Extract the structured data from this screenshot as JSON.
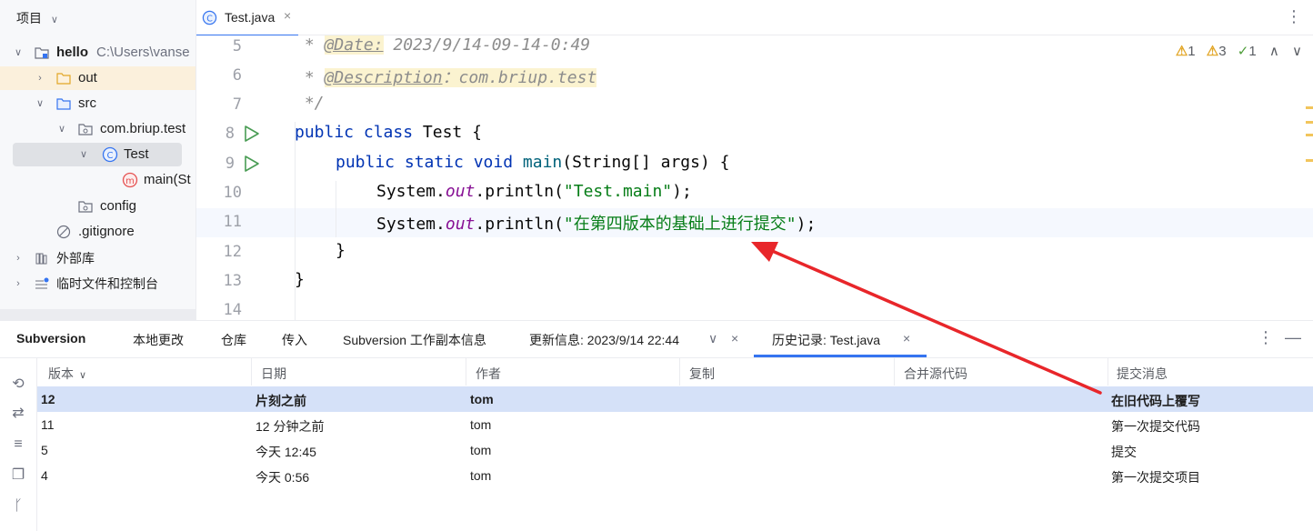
{
  "project": {
    "title": "项目",
    "tree": [
      {
        "label": "hello",
        "suffix": "C:\\Users\\vanse"
      },
      {
        "label": "out"
      },
      {
        "label": "src"
      },
      {
        "label": "com.briup.test"
      },
      {
        "label": "Test"
      },
      {
        "label": "main(St"
      },
      {
        "label": "config"
      },
      {
        "label": ".gitignore"
      },
      {
        "label": "外部库"
      },
      {
        "label": "临时文件和控制台"
      }
    ]
  },
  "editor": {
    "tab_label": "Test.java",
    "inspections": {
      "warn1": "1",
      "warn2": "3",
      "ok": "1"
    },
    "lines": [
      "5",
      "6",
      "7",
      "8",
      "9",
      "10",
      "11",
      "12",
      "13",
      "14"
    ],
    "code": {
      "l5_prefix": " * ",
      "l5_tag": "@Date:",
      "l5_value": " 2023/9/14-09-14-0:49",
      "l6_prefix": " * ",
      "l6_tag": "@Description",
      "l6_value": "：com.briup.test",
      "l7": " */",
      "l8_kw": "public class ",
      "l8_rest": "Test {",
      "l9_kw": "public static void ",
      "l9_fn": "main",
      "l9_rest": "(String[] args) {",
      "l10_a": "System.",
      "l10_out": "out",
      "l10_b": ".println(",
      "l10_str": "\"Test.main\"",
      "l10_c": ");",
      "l11_a": "System.",
      "l11_out": "out",
      "l11_b": ".println(",
      "l11_str": "\"在第四版本的基础上进行提交\"",
      "l11_c": ");",
      "l12": "}",
      "l13": "}"
    }
  },
  "tool": {
    "tabs": {
      "svn": "Subversion",
      "local": "本地更改",
      "repo": "仓库",
      "incoming": "传入",
      "wcinfo": "Subversion 工作副本信息",
      "update": "更新信息: 2023/9/14 22:44",
      "history": "历史记录: Test.java"
    },
    "columns": [
      "版本",
      "日期",
      "作者",
      "复制",
      "合并源代码",
      "提交消息"
    ],
    "rows": [
      {
        "rev": "12",
        "date": "片刻之前",
        "author": "tom",
        "copy": "",
        "merge": "",
        "msg": "在旧代码上覆写"
      },
      {
        "rev": "11",
        "date": "12 分钟之前",
        "author": "tom",
        "copy": "",
        "merge": "",
        "msg": "第一次提交代码"
      },
      {
        "rev": "5",
        "date": "今天 12:45",
        "author": "tom",
        "copy": "",
        "merge": "",
        "msg": "提交"
      },
      {
        "rev": "4",
        "date": "今天 0:56",
        "author": "tom",
        "copy": "",
        "merge": "",
        "msg": "第一次提交项目"
      }
    ]
  },
  "colors": {
    "accent": "#3574f0",
    "annotation_arrow": "#e8262a",
    "selected_row": "#d5e1f8"
  }
}
